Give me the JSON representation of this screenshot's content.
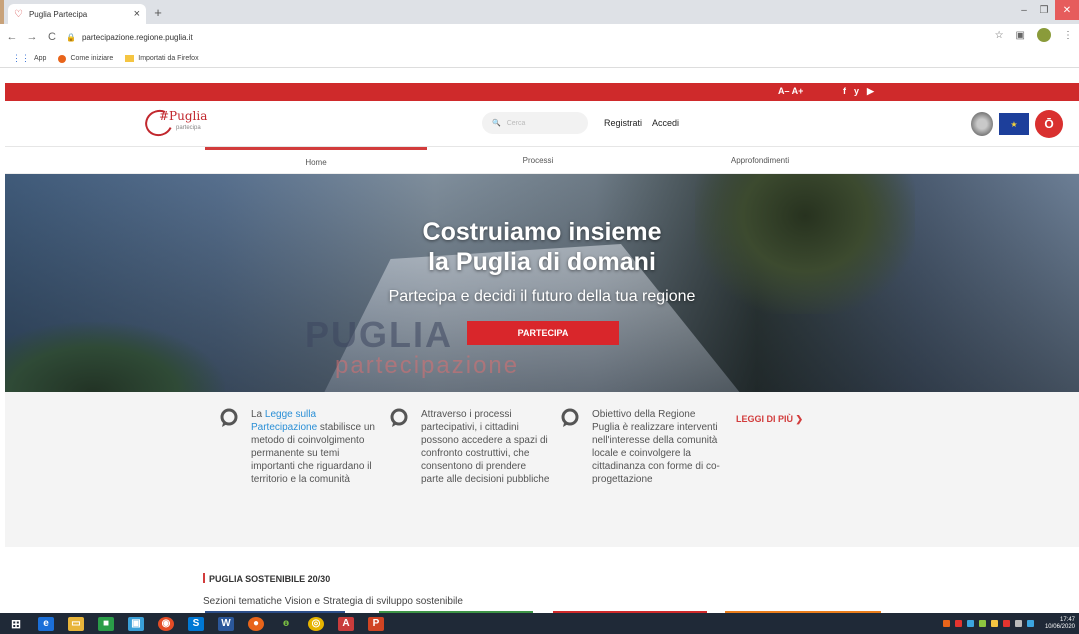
{
  "browser": {
    "tab_title": "Puglia Partecipa",
    "tab_close": "×",
    "new_tab": "+",
    "url": "partecipazione.regione.puglia.it",
    "bookmarks": [
      "App",
      "Come iniziare",
      "Importati da Firefox"
    ]
  },
  "site": {
    "font_controls": "A– A+",
    "social": [
      "f",
      "y",
      "▶"
    ],
    "logo": {
      "main": "#Puglia",
      "sub": "partecipa"
    },
    "search_placeholder": "Cerca",
    "auth": {
      "register": "Registrati",
      "login": "Accedi"
    },
    "nav": [
      "Home",
      "Processi",
      "Approfondimenti"
    ]
  },
  "hero": {
    "title_line1": "Costruiamo insieme",
    "title_line2": "la Puglia di domani",
    "subtitle": "Partecipa e decidi il futuro della tua regione",
    "cta": "PARTECIPA",
    "bg_text_1": "PUGLIA",
    "bg_text_2": "partecipazione"
  },
  "info": {
    "col1": {
      "prefix": "La ",
      "link": "Legge sulla Partecipazione",
      "rest": " stabilisce un metodo di coinvolgimento permanente su temi importanti che riguardano il territorio e la comunità"
    },
    "col2": "Attraverso i processi partecipativi, i cittadini possono accedere a spazi di confronto costruttivi, che consentono di prendere parte alle decisioni pubbliche",
    "col3": "Obiettivo della Regione Puglia è realizzare interventi nell'interesse della comunità locale e coinvolgere la cittadinanza con forme di co-progettazione",
    "read_more": "LEGGI DI PIÙ ❯"
  },
  "section": {
    "title": "PUGLIA SOSTENIBILE 20/30",
    "subtitle": "Sezioni tematiche Vision e Strategia di sviluppo sostenibile"
  },
  "taskbar": {
    "clock_time": "17:47",
    "clock_date": "10/06/2020"
  }
}
